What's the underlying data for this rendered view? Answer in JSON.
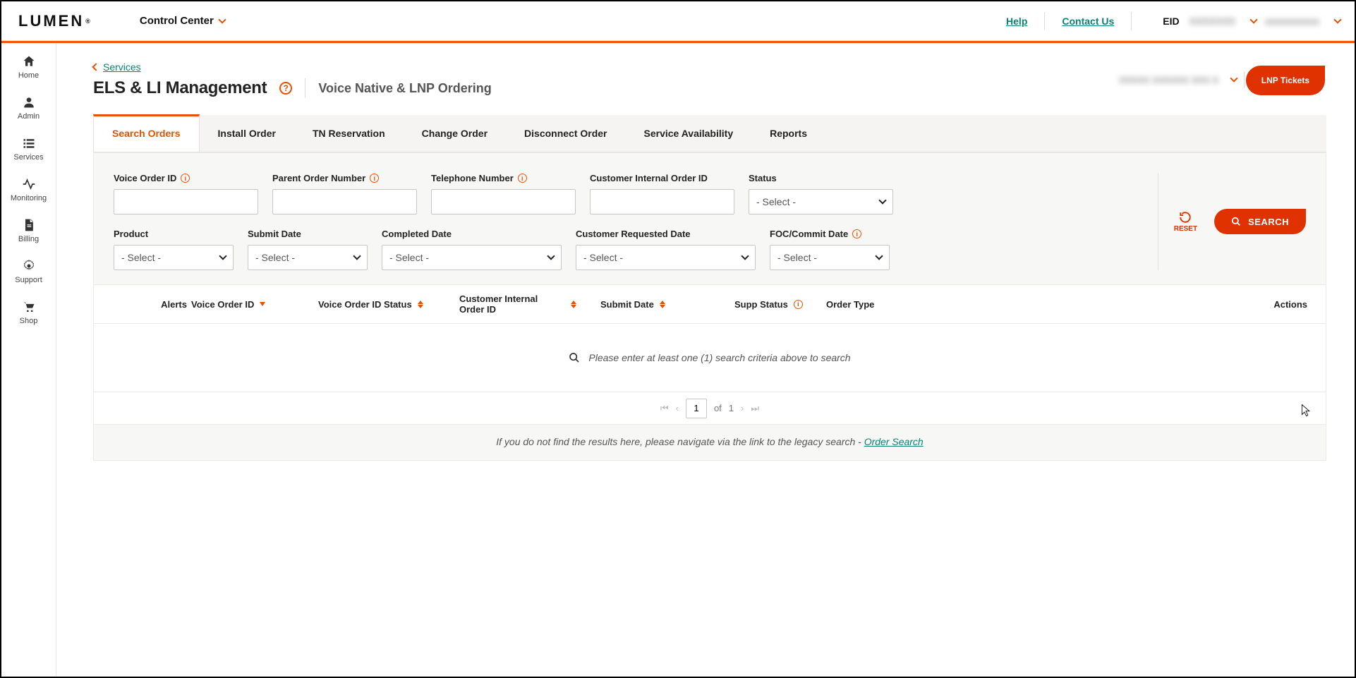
{
  "brand": {
    "name": "LUMEN",
    "reg": "®"
  },
  "topnav": {
    "control_center": "Control Center",
    "help": "Help",
    "contact": "Contact Us",
    "eid_label": "EID",
    "eid_value": "XXXXXXX",
    "user_value": "xxxxxxxxxxx"
  },
  "sidebar": {
    "items": [
      {
        "id": "home",
        "label": "Home"
      },
      {
        "id": "admin",
        "label": "Admin"
      },
      {
        "id": "services",
        "label": "Services"
      },
      {
        "id": "monitoring",
        "label": "Monitoring"
      },
      {
        "id": "billing",
        "label": "Billing"
      },
      {
        "id": "support",
        "label": "Support"
      },
      {
        "id": "shop",
        "label": "Shop"
      }
    ]
  },
  "breadcrumb": {
    "services": "Services"
  },
  "page": {
    "title": "ELS & LI Management",
    "subtitle": "Voice Native & LNP Ordering",
    "account": "XXXXX XXXXXX XXX X",
    "lnp_button": "LNP Tickets"
  },
  "tabs": [
    {
      "id": "search-orders",
      "label": "Search Orders",
      "active": true
    },
    {
      "id": "install-order",
      "label": "Install Order"
    },
    {
      "id": "tn-reservation",
      "label": "TN Reservation"
    },
    {
      "id": "change-order",
      "label": "Change Order"
    },
    {
      "id": "disconnect-order",
      "label": "Disconnect Order"
    },
    {
      "id": "service-availability",
      "label": "Service Availability"
    },
    {
      "id": "reports",
      "label": "Reports"
    }
  ],
  "filters": {
    "voice_order_id": {
      "label": "Voice Order ID"
    },
    "parent_order_number": {
      "label": "Parent Order Number"
    },
    "telephone_number": {
      "label": "Telephone Number"
    },
    "customer_internal_order_id": {
      "label": "Customer Internal Order ID"
    },
    "status": {
      "label": "Status",
      "placeholder": "- Select -"
    },
    "product": {
      "label": "Product",
      "placeholder": "- Select -"
    },
    "submit_date": {
      "label": "Submit Date",
      "placeholder": "- Select -"
    },
    "completed_date": {
      "label": "Completed Date",
      "placeholder": "- Select -"
    },
    "customer_requested_date": {
      "label": "Customer Requested Date",
      "placeholder": "- Select -"
    },
    "foc_commit_date": {
      "label": "FOC/Commit Date",
      "placeholder": "- Select -"
    },
    "reset": "RESET",
    "search": "SEARCH"
  },
  "columns": {
    "alerts": "Alerts",
    "voice_order_id": "Voice Order ID",
    "voice_order_id_status": "Voice Order ID Status",
    "customer_internal_order_id": "Customer Internal Order ID",
    "submit_date": "Submit Date",
    "supp_status": "Supp Status",
    "order_type": "Order Type",
    "actions": "Actions"
  },
  "results": {
    "empty_message": "Please enter at least one (1) search criteria above to search"
  },
  "pager": {
    "page": "1",
    "of": "of",
    "total": "1"
  },
  "legacy": {
    "text": "If you do not find the results here, please navigate via the link to the legacy search - ",
    "link": "Order Search"
  }
}
